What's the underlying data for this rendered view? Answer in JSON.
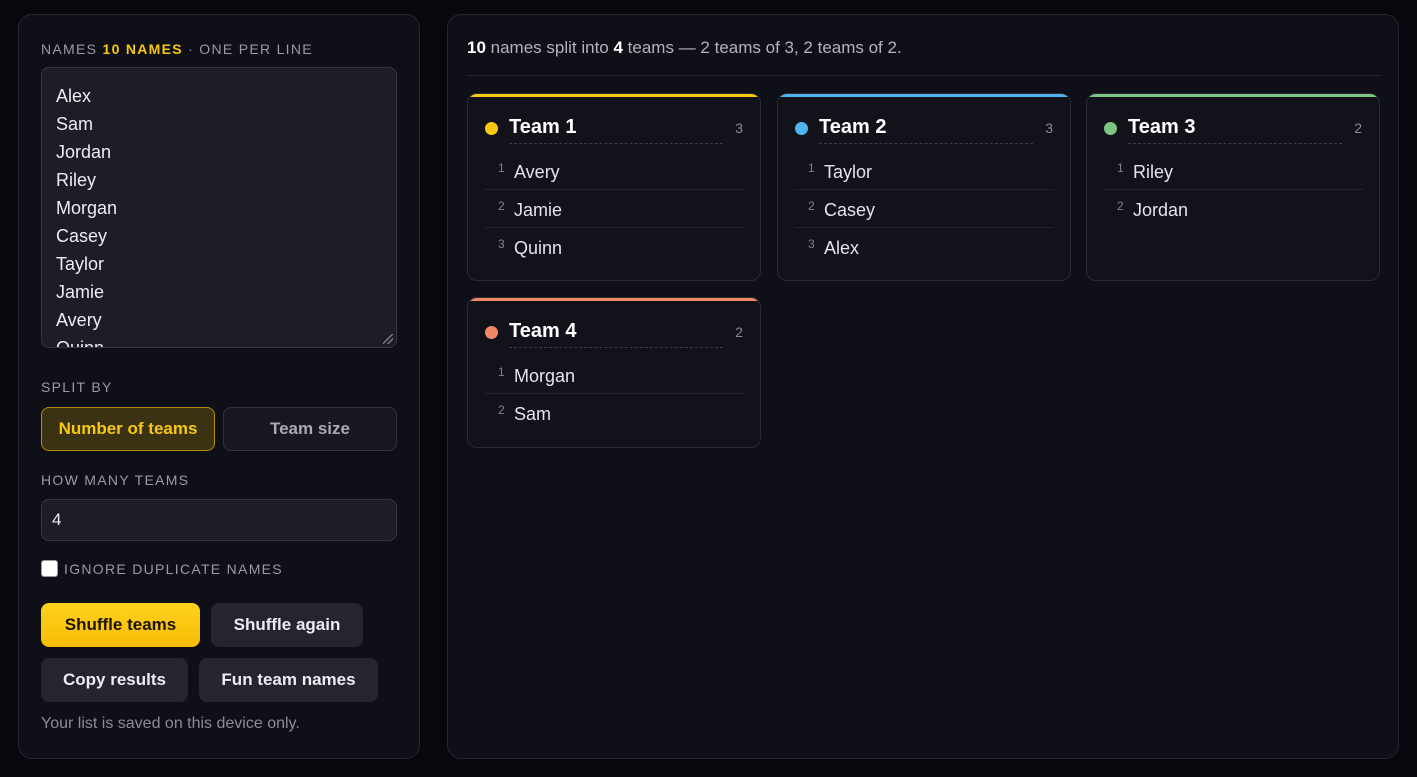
{
  "left": {
    "names_label": "NAMES",
    "names_count": "10 NAMES",
    "names_hint": "· ONE PER LINE",
    "names": [
      "Alex",
      "Sam",
      "Jordan",
      "Riley",
      "Morgan",
      "Casey",
      "Taylor",
      "Jamie",
      "Avery",
      "Quinn"
    ],
    "split_by_label": "SPLIT BY",
    "split_options": [
      "Number of teams",
      "Team size"
    ],
    "split_selected": "Number of teams",
    "how_many_label": "HOW MANY TEAMS",
    "how_many_value": "4",
    "ignore_duplicates_label": "IGNORE DUPLICATE NAMES",
    "ignore_duplicates_checked": false,
    "buttons": {
      "shuffle": "Shuffle teams",
      "shuffle_again": "Shuffle again",
      "copy": "Copy results",
      "fun_names": "Fun team names"
    },
    "saved_note": "Your list is saved on this device only."
  },
  "summary": {
    "names_count": "10",
    "text_a": " names split into ",
    "teams_count": "4",
    "text_b": " teams — 2 teams of 3, 2 teams of 2."
  },
  "teams": [
    {
      "name": "Team 1",
      "count": "3",
      "color": "#f6c80f",
      "members": [
        "Avery",
        "Jamie",
        "Quinn"
      ]
    },
    {
      "name": "Team 2",
      "count": "3",
      "color": "#4fb4ee",
      "members": [
        "Taylor",
        "Casey",
        "Alex"
      ]
    },
    {
      "name": "Team 3",
      "count": "2",
      "color": "#7cc47f",
      "members": [
        "Riley",
        "Jordan"
      ]
    },
    {
      "name": "Team 4",
      "count": "2",
      "color": "#f08766",
      "members": [
        "Morgan",
        "Sam"
      ]
    }
  ]
}
